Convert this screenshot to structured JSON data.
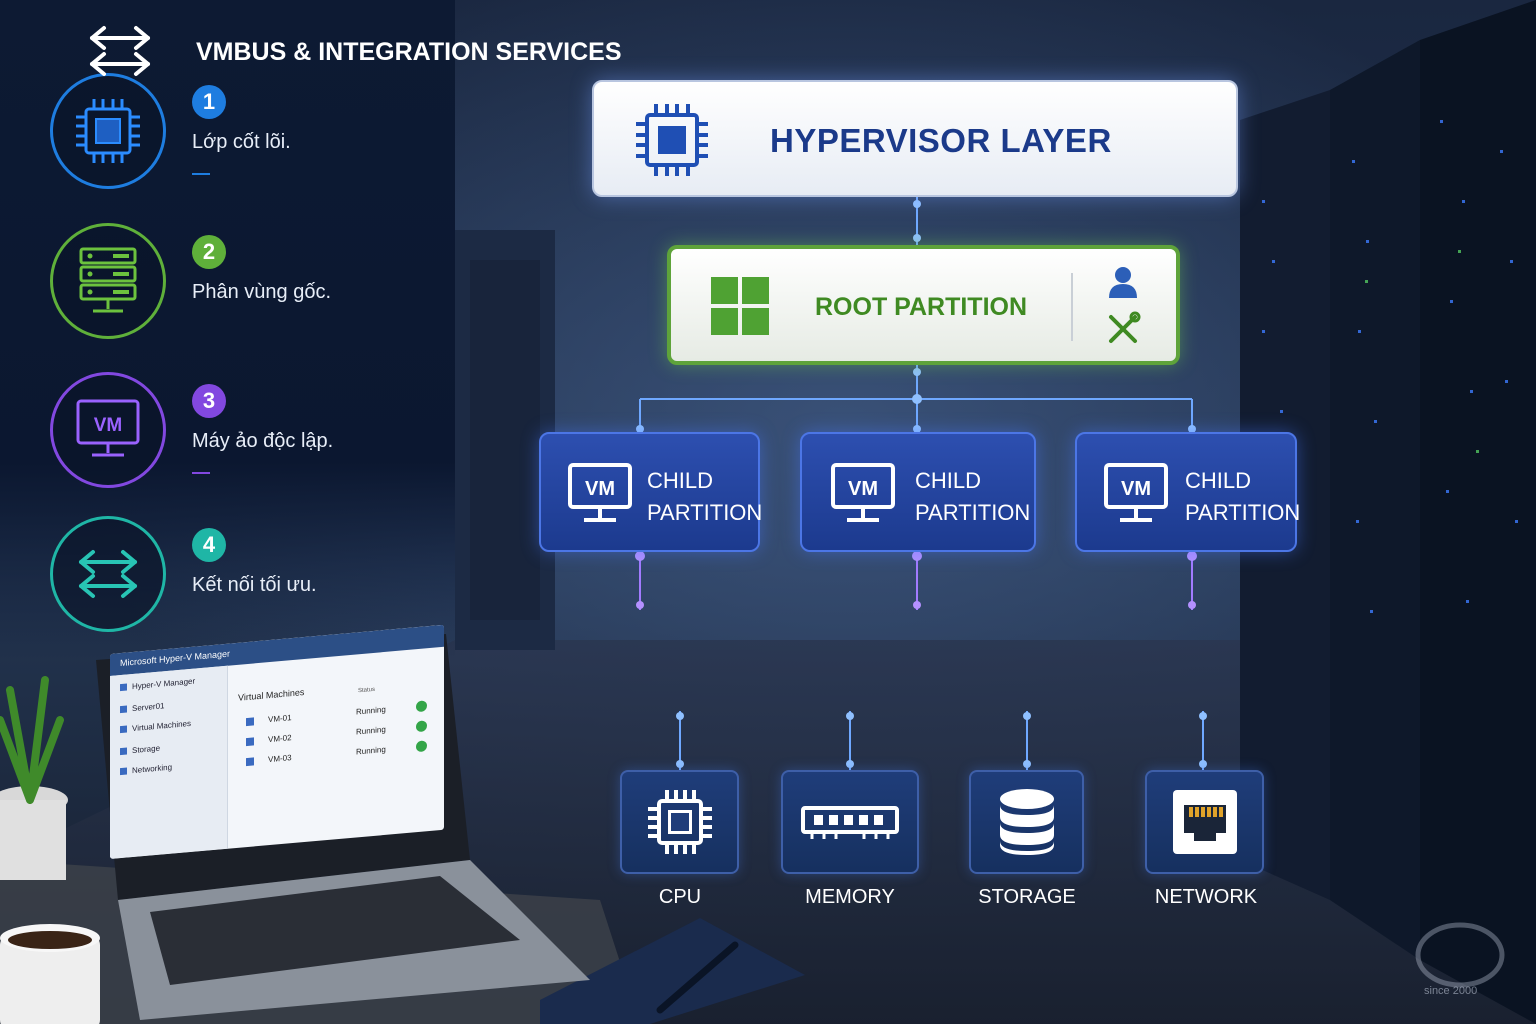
{
  "legend": [
    {
      "num": "1",
      "text": "Lớp cốt lõi.",
      "color": "#1e7de0",
      "icon": "cpu-chip-icon"
    },
    {
      "num": "2",
      "text": "Phân vùng gốc.",
      "color": "#5fb03a",
      "icon": "server-icon"
    },
    {
      "num": "3",
      "text": "Máy ảo độc lập.",
      "color": "#8248e0",
      "icon": "vm-monitor-icon"
    },
    {
      "num": "4",
      "text": "Kết nối tối ưu.",
      "color": "#1fb6a6",
      "icon": "exchange-arrows-icon"
    }
  ],
  "diagram": {
    "hypervisor": {
      "label": "HYPERVISOR LAYER",
      "icon": "cpu-chip-icon"
    },
    "root_partition": {
      "label": "ROOT PARTITION",
      "icons": [
        "windows-logo-icon",
        "user-icon",
        "tools-icon"
      ]
    },
    "child_partitions": [
      {
        "vm": "VM",
        "line1": "CHILD",
        "line2": "PARTITION"
      },
      {
        "vm": "VM",
        "line1": "CHILD",
        "line2": "PARTITION"
      },
      {
        "vm": "VM",
        "line1": "CHILD",
        "line2": "PARTITION"
      }
    ],
    "vmbus": {
      "label": "VMBUS & INTEGRATION SERVICES",
      "icon": "exchange-arrows-icon"
    },
    "resources": [
      {
        "label": "CPU",
        "icon": "cpu-chip-icon"
      },
      {
        "label": "MEMORY",
        "icon": "memory-module-icon"
      },
      {
        "label": "STORAGE",
        "icon": "database-icon"
      },
      {
        "label": "NETWORK",
        "icon": "ethernet-port-icon"
      }
    ]
  },
  "laptop": {
    "window_title": "Microsoft Hyper-V Manager",
    "sidebar": [
      "Hyper-V Manager",
      "Server01",
      "Virtual Machines",
      "Storage",
      "Networking"
    ],
    "main_title": "Virtual Machines",
    "status_header": "Status",
    "vms": [
      {
        "name": "VM-01",
        "status": "Running"
      },
      {
        "name": "VM-02",
        "status": "Running"
      },
      {
        "name": "VM-03",
        "status": "Running"
      }
    ]
  },
  "watermark": "since 2000",
  "colors": {
    "hypervisor_text": "#1b3a8a",
    "root_green": "#5ea33a",
    "child_blue": "#2d4fb0",
    "vmbus_purple": "#6a35d6",
    "connector_line": "#6fa8ff"
  }
}
